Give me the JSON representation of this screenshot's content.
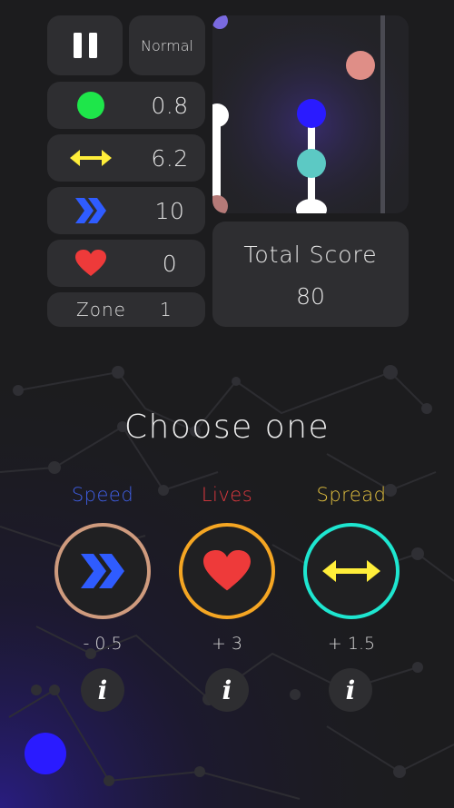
{
  "hud": {
    "difficulty": "Normal",
    "stats": [
      {
        "name": "size",
        "icon": "green-dot-icon",
        "value": "0.8"
      },
      {
        "name": "spread",
        "icon": "double-arrow-icon",
        "value": "6.2"
      },
      {
        "name": "speed",
        "icon": "chevron-icon",
        "value": "10"
      },
      {
        "name": "lives",
        "icon": "heart-icon",
        "value": "0"
      }
    ],
    "zone_label": "Zone",
    "zone_value": "1",
    "total_score_label": "Total Score",
    "total_score_value": "80"
  },
  "choose": {
    "title": "Choose one",
    "options": [
      {
        "label": "Speed",
        "delta": "- 0.5",
        "icon": "speed-chevron-icon",
        "label_color": "#3f5fe6",
        "ring_color": "#cf9b7e"
      },
      {
        "label": "Lives",
        "delta": "+ 3",
        "icon": "heart-icon",
        "label_color": "#e0393f",
        "ring_color": "#f5a623"
      },
      {
        "label": "Spread",
        "delta": "+ 1.5",
        "icon": "spread-arrow-icon",
        "label_color": "#e3c13f",
        "ring_color": "#1ee6d0"
      }
    ],
    "info_glyph": "i"
  },
  "colors": {
    "player_blue": "#2a1bff",
    "green": "#1ee64a",
    "yellow": "#ffee3a",
    "red_heart": "#ee3a3a",
    "speed_blue": "#2f5cff",
    "teal": "#5cc9c4",
    "salmon": "#df8e87"
  }
}
